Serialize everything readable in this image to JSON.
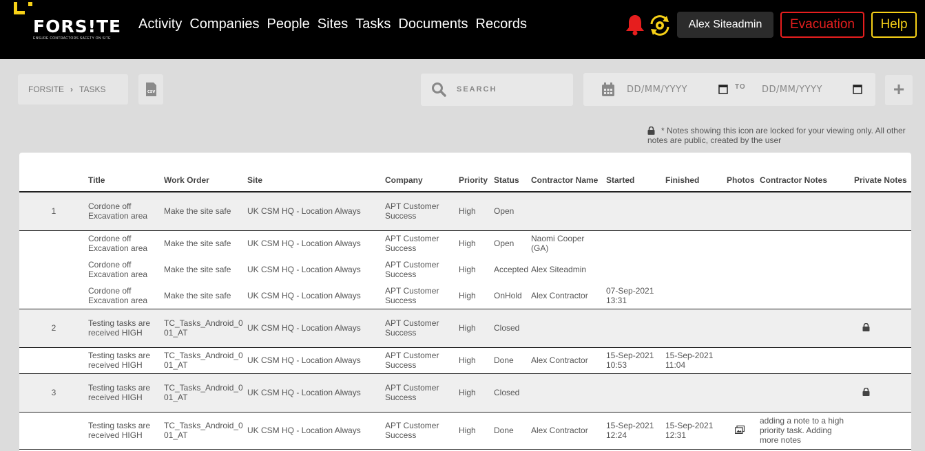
{
  "brand": {
    "logo_text": "FORS!TE",
    "tagline": "ENSURE CONTRACTORS SAFETY ON SITE",
    "accent_yellow": "#f7d117",
    "alert_red": "#e61e1e"
  },
  "nav": {
    "items": [
      "Activity",
      "Companies",
      "People",
      "Sites",
      "Tasks",
      "Documents",
      "Records"
    ]
  },
  "header": {
    "notification_icon": "bell-icon",
    "sync_icon": "sync-gear-icon",
    "user_name": "Alex Siteadmin",
    "evacuation_label": "Evacuation",
    "help_label": "Help"
  },
  "breadcrumb": {
    "root": "FORSITE",
    "current": "TASKS"
  },
  "toolbar": {
    "csv_icon": "csv-file-icon",
    "search_placeholder": "SEARCH",
    "date_from_placeholder": "DD/MM/YYYY",
    "date_to_label": "TO",
    "date_to_placeholder": "DD/MM/YYYY",
    "add_icon": "plus-icon"
  },
  "notes_info": "* Notes showing this icon are locked for your viewing only. All other notes are public, created by the user",
  "table": {
    "columns": [
      "",
      "Title",
      "Work Order",
      "Site",
      "Company",
      "Priority",
      "Status",
      "Contractor Name",
      "Started",
      "Finished",
      "Photos",
      "Contractor Notes",
      "Private Notes"
    ],
    "rows": [
      {
        "type": "main",
        "num": "1",
        "title": "Cordone off Excavation area",
        "work_order": "Make the site safe",
        "site": "UK CSM HQ - Location Always",
        "company": "APT Customer Success",
        "priority": "High",
        "status": "Open",
        "contractor": "",
        "started": "",
        "finished": "",
        "photos": false,
        "notes": "",
        "private": false
      },
      {
        "type": "sub",
        "num": "",
        "title": "Cordone off Excavation area",
        "work_order": "Make the site safe",
        "site": "UK CSM HQ - Location Always",
        "company": "APT Customer Success",
        "priority": "High",
        "status": "Open",
        "contractor": "Naomi Cooper (GA)",
        "started": "",
        "finished": "",
        "photos": false,
        "notes": "",
        "private": false
      },
      {
        "type": "sub",
        "num": "",
        "title": "Cordone off Excavation area",
        "work_order": "Make the site safe",
        "site": "UK CSM HQ - Location Always",
        "company": "APT Customer Success",
        "priority": "High",
        "status": "Accepted",
        "contractor": "Alex Siteadmin",
        "started": "",
        "finished": "",
        "photos": false,
        "notes": "",
        "private": false
      },
      {
        "type": "sub-last",
        "num": "",
        "title": "Cordone off Excavation area",
        "work_order": "Make the site safe",
        "site": "UK CSM HQ - Location Always",
        "company": "APT Customer Success",
        "priority": "High",
        "status": "OnHold",
        "contractor": "Alex Contractor",
        "started": "07-Sep-2021 13:31",
        "finished": "",
        "photos": false,
        "notes": "",
        "private": false
      },
      {
        "type": "main",
        "num": "2",
        "title": "Testing tasks are received HIGH",
        "work_order": "TC_Tasks_Android_001_AT",
        "site": "UK CSM HQ - Location Always",
        "company": "APT Customer Success",
        "priority": "High",
        "status": "Closed",
        "contractor": "",
        "started": "",
        "finished": "",
        "photos": false,
        "notes": "",
        "private": true
      },
      {
        "type": "sub-last",
        "num": "",
        "title": "Testing tasks are received HIGH",
        "work_order": "TC_Tasks_Android_001_AT",
        "site": "UK CSM HQ - Location Always",
        "company": "APT Customer Success",
        "priority": "High",
        "status": "Done",
        "contractor": "Alex Contractor",
        "started": "15-Sep-2021 10:53",
        "finished": "15-Sep-2021 11:04",
        "photos": false,
        "notes": "",
        "private": false
      },
      {
        "type": "main",
        "num": "3",
        "title": "Testing tasks are received HIGH",
        "work_order": "TC_Tasks_Android_001_AT",
        "site": "UK CSM HQ - Location Always",
        "company": "APT Customer Success",
        "priority": "High",
        "status": "Closed",
        "contractor": "",
        "started": "",
        "finished": "",
        "photos": false,
        "notes": "",
        "private": true
      },
      {
        "type": "sub-last-tall",
        "num": "",
        "title": "Testing tasks are received HIGH",
        "work_order": "TC_Tasks_Android_001_AT",
        "site": "UK CSM HQ - Location Always",
        "company": "APT Customer Success",
        "priority": "High",
        "status": "Done",
        "contractor": "Alex Contractor",
        "started": "15-Sep-2021 12:24",
        "finished": "15-Sep-2021 12:31",
        "photos": true,
        "notes": "adding a note to a high priority task. Adding more notes",
        "private": false
      }
    ]
  }
}
